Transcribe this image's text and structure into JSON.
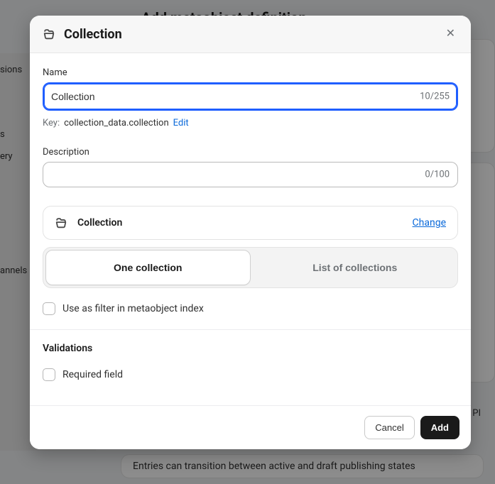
{
  "background": {
    "page_title": "Add metaobject definition",
    "sidebar_sample_items": [
      "sions",
      "s",
      "ery",
      "annels"
    ],
    "api_label": "PI",
    "note": "Entries can transition between active and draft publishing states"
  },
  "modal": {
    "title": "Collection",
    "close_label": "✕"
  },
  "name": {
    "label": "Name",
    "value": "Collection",
    "count": "10/255"
  },
  "key_line": {
    "prefix": "Key:",
    "value": "collection_data.collection",
    "edit": "Edit"
  },
  "description": {
    "label": "Description",
    "value": "",
    "count": "0/100"
  },
  "type_card": {
    "name": "Collection",
    "change": "Change"
  },
  "segmented": {
    "one": "One collection",
    "list": "List of collections"
  },
  "filter_checkbox": {
    "label": "Use as filter in metaobject index"
  },
  "validations": {
    "heading": "Validations",
    "required_label": "Required field"
  },
  "footer": {
    "cancel": "Cancel",
    "add": "Add"
  }
}
